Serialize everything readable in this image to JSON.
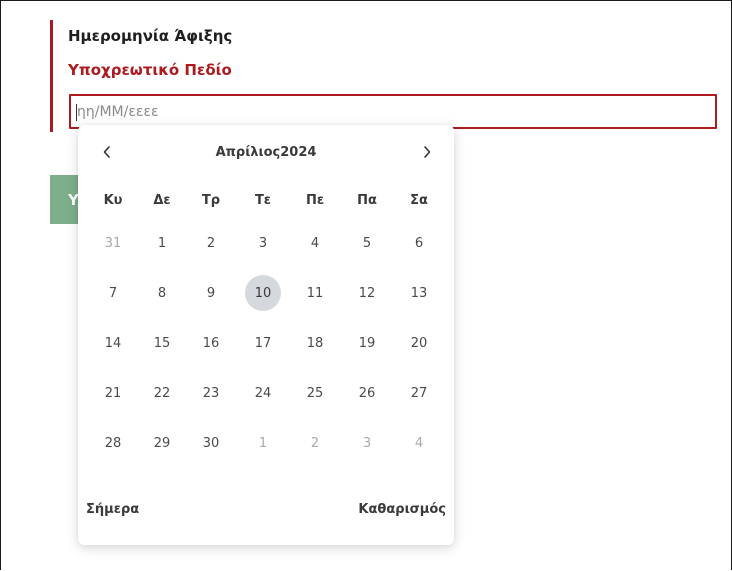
{
  "form": {
    "field_label": "Ημερομηνία Άφιξης",
    "error_text": "Υποχρεωτικό Πεδίο",
    "input_placeholder": "ηη/ΜΜ/εεεε",
    "input_value": "",
    "submit_label": "Υ",
    "error_color": "#ab1b1f",
    "submit_color": "#7daf8b"
  },
  "calendar": {
    "month_title": "Απρίλιος2024",
    "prev_icon": "chevron-left-icon",
    "next_icon": "chevron-right-icon",
    "weekdays": [
      "Κυ",
      "Δε",
      "Τρ",
      "Τε",
      "Πε",
      "Πα",
      "Σα"
    ],
    "weeks": [
      [
        {
          "d": "31",
          "muted": true
        },
        {
          "d": "1"
        },
        {
          "d": "2"
        },
        {
          "d": "3"
        },
        {
          "d": "4"
        },
        {
          "d": "5"
        },
        {
          "d": "6"
        }
      ],
      [
        {
          "d": "7"
        },
        {
          "d": "8"
        },
        {
          "d": "9"
        },
        {
          "d": "10",
          "today": true
        },
        {
          "d": "11"
        },
        {
          "d": "12"
        },
        {
          "d": "13"
        }
      ],
      [
        {
          "d": "14"
        },
        {
          "d": "15"
        },
        {
          "d": "16"
        },
        {
          "d": "17"
        },
        {
          "d": "18"
        },
        {
          "d": "19"
        },
        {
          "d": "20"
        }
      ],
      [
        {
          "d": "21"
        },
        {
          "d": "22"
        },
        {
          "d": "23"
        },
        {
          "d": "24"
        },
        {
          "d": "25"
        },
        {
          "d": "26"
        },
        {
          "d": "27"
        }
      ],
      [
        {
          "d": "28"
        },
        {
          "d": "29"
        },
        {
          "d": "30"
        },
        {
          "d": "1",
          "muted": true
        },
        {
          "d": "2",
          "muted": true
        },
        {
          "d": "3",
          "muted": true
        },
        {
          "d": "4",
          "muted": true
        }
      ]
    ],
    "today_label": "Σήμερα",
    "clear_label": "Καθαρισμός"
  }
}
